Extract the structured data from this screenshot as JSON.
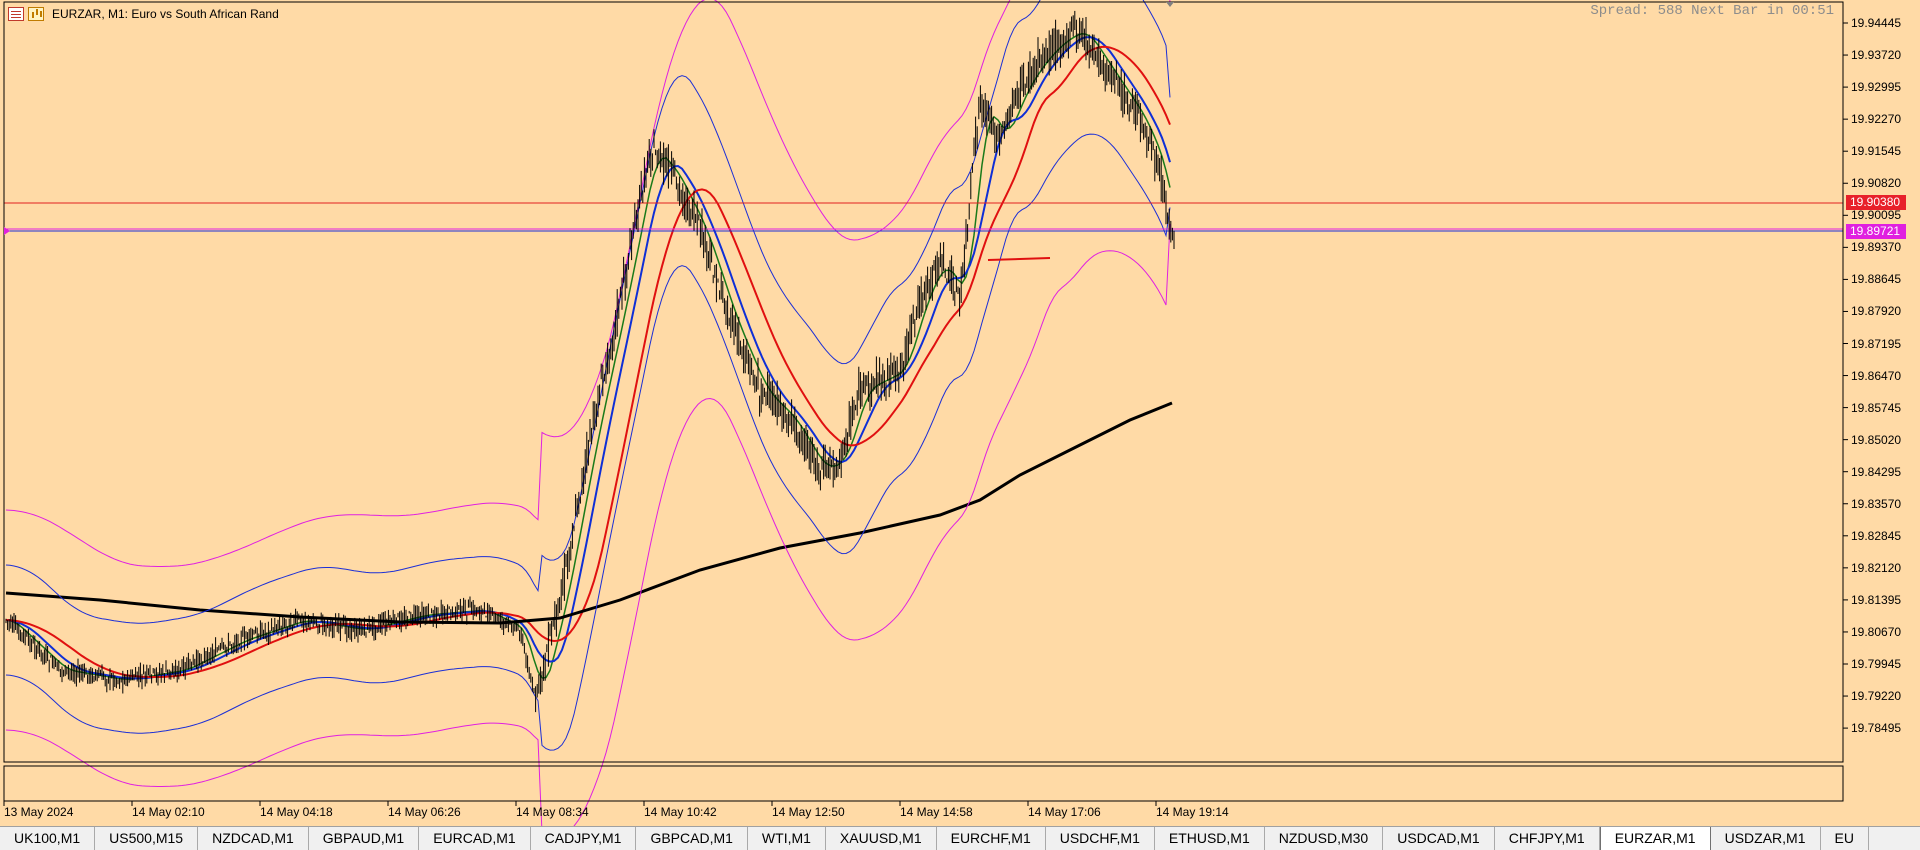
{
  "window": {
    "title": "EURZAR, M1:  Euro vs South African Rand",
    "spread_text": "Spread: 588 Next Bar in 00:51"
  },
  "colors": {
    "background": "#ffdaa6",
    "candles": "#000000",
    "ma_fast_green": "#1a7a1a",
    "ma_blue": "#0f2fd6",
    "ma_red": "#e01010",
    "ma_black": "#000000",
    "bollinger_inner": "#1c2fd6",
    "bollinger_outer": "#e020e0",
    "level_red": "#e02020",
    "level_bid": "#1c2fd6",
    "tag_red": "#e8202a",
    "tag_magenta": "#e020e0"
  },
  "price_axis": {
    "labels": [
      "19.94445",
      "19.93720",
      "19.92995",
      "19.92270",
      "19.91545",
      "19.90820",
      "19.90095",
      "19.89370",
      "19.88645",
      "19.87920",
      "19.87195",
      "19.86470",
      "19.85745",
      "19.85020",
      "19.84295",
      "19.83570",
      "19.82845",
      "19.82120",
      "19.81395",
      "19.80670",
      "19.79945",
      "19.79220",
      "19.78495"
    ],
    "red_level_tag": "19.90380",
    "bid_tag": "19.89721"
  },
  "time_axis": {
    "labels": [
      "13 May 2024",
      "14 May 02:10",
      "14 May 04:18",
      "14 May 06:26",
      "14 May 08:34",
      "14 May 10:42",
      "14 May 12:50",
      "14 May 14:58",
      "14 May 17:06",
      "14 May 19:14"
    ]
  },
  "tabs": [
    {
      "label": "UK100,M1"
    },
    {
      "label": "US500,M15"
    },
    {
      "label": "NZDCAD,M1"
    },
    {
      "label": "GBPAUD,M1"
    },
    {
      "label": "EURCAD,M1"
    },
    {
      "label": "CADJPY,M1"
    },
    {
      "label": "GBPCAD,M1"
    },
    {
      "label": "WTI,M1"
    },
    {
      "label": "XAUUSD,M1"
    },
    {
      "label": "EURCHF,M1"
    },
    {
      "label": "USDCHF,M1"
    },
    {
      "label": "ETHUSD,M1"
    },
    {
      "label": "NZDUSD,M30"
    },
    {
      "label": "USDCAD,M1"
    },
    {
      "label": "CHFJPY,M1"
    },
    {
      "label": "EURZAR,M1",
      "active": true
    },
    {
      "label": "USDZAR,M1"
    },
    {
      "label": "EU"
    }
  ]
}
